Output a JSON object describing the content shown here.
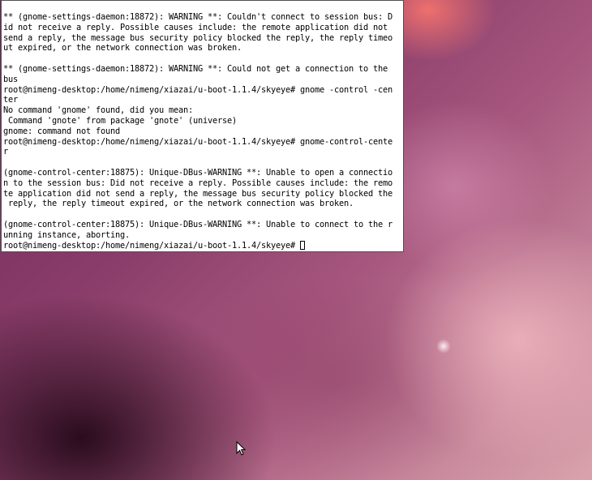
{
  "terminal": {
    "lines": [
      "** (gnome-settings-daemon:18872): WARNING **: Couldn't connect to session bus: D",
      "id not receive a reply. Possible causes include: the remote application did not",
      "send a reply, the message bus security policy blocked the reply, the reply timeo",
      "ut expired, or the network connection was broken.",
      "",
      "** (gnome-settings-daemon:18872): WARNING **: Could not get a connection to the",
      "bus",
      "root@nimeng-desktop:/home/nimeng/xiazai/u-boot-1.1.4/skyeye# gnome -control -cen",
      "ter",
      "No command 'gnome' found, did you mean:",
      " Command 'gnote' from package 'gnote' (universe)",
      "gnome: command not found",
      "root@nimeng-desktop:/home/nimeng/xiazai/u-boot-1.1.4/skyeye# gnome-control-cente",
      "r",
      "",
      "(gnome-control-center:18875): Unique-DBus-WARNING **: Unable to open a connectio",
      "n to the session bus: Did not receive a reply. Possible causes include: the remo",
      "te application did not send a reply, the message bus security policy blocked the",
      " reply, the reply timeout expired, or the network connection was broken.",
      "",
      "(gnome-control-center:18875): Unique-DBus-WARNING **: Unable to connect to the r",
      "unning instance, aborting."
    ],
    "prompt": "root@nimeng-desktop:/home/nimeng/xiazai/u-boot-1.1.4/skyeye# "
  },
  "icons": {
    "cursor": "text-cursor-block-icon",
    "pointer": "mouse-pointer-icon"
  },
  "colors": {
    "terminal_bg": "#ffffff",
    "terminal_fg": "#000000"
  }
}
